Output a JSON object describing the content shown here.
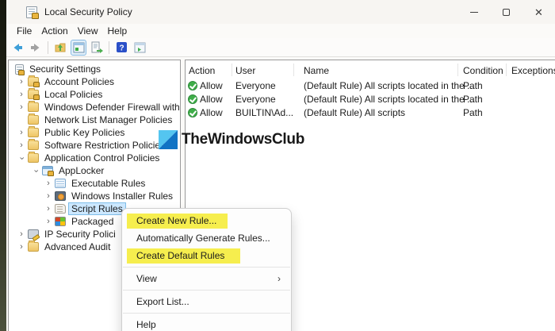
{
  "window": {
    "title": "Local Security Policy",
    "controls": {
      "minimize": "minimize",
      "maximize": "maximize",
      "close": "close"
    }
  },
  "menubar": {
    "items": [
      "File",
      "Action",
      "View",
      "Help"
    ]
  },
  "toolbar": {
    "icons": [
      "back-icon",
      "forward-icon",
      "up-folder-icon",
      "console-window-icon",
      "export-list-icon",
      "help-icon",
      "action-pane-icon"
    ]
  },
  "tree": {
    "items": [
      {
        "label": "Security Settings"
      },
      {
        "label": "Account Policies"
      },
      {
        "label": "Local Policies"
      },
      {
        "label": "Windows Defender Firewall with Adva"
      },
      {
        "label": "Network List Manager Policies"
      },
      {
        "label": "Public Key Policies"
      },
      {
        "label": "Software Restriction Policies"
      },
      {
        "label": "Application Control Policies"
      },
      {
        "label": "AppLocker"
      },
      {
        "label": "Executable Rules"
      },
      {
        "label": "Windows Installer Rules"
      },
      {
        "label": "Script Rules"
      },
      {
        "label": "Packaged"
      },
      {
        "label": "IP Security Polici"
      },
      {
        "label": "Advanced Audit"
      }
    ]
  },
  "list": {
    "columns": {
      "action": "Action",
      "user": "User",
      "name": "Name",
      "condition": "Condition",
      "exceptions": "Exceptions"
    },
    "rows": [
      {
        "action": "Allow",
        "user": "Everyone",
        "name": "(Default Rule) All scripts located in the ...",
        "condition": "Path"
      },
      {
        "action": "Allow",
        "user": "Everyone",
        "name": "(Default Rule) All scripts located in the ...",
        "condition": "Path"
      },
      {
        "action": "Allow",
        "user": "BUILTIN\\Ad...",
        "name": "(Default Rule) All scripts",
        "condition": "Path"
      }
    ]
  },
  "watermark": {
    "text": "TheWindowsClub",
    "logo_top_color": "#54c5f0",
    "logo_bottom_color": "#1173c4"
  },
  "context_menu": {
    "items": {
      "create_new_rule": "Create New Rule...",
      "auto_generate": "Automatically Generate Rules...",
      "create_default": "Create Default Rules",
      "view": "View",
      "export_list": "Export List...",
      "help": "Help"
    }
  },
  "colors": {
    "highlight_yellow": "#f6ee4e",
    "tree_selection_blue": "#cce8ff",
    "allow_green": "#3fae49",
    "pane_border": "#9a9a9a"
  }
}
